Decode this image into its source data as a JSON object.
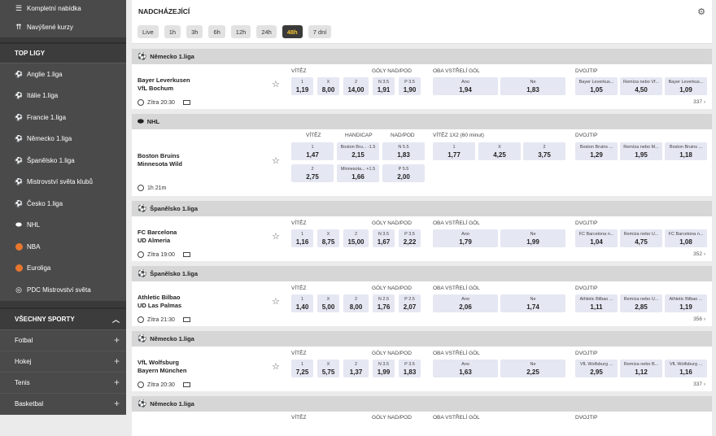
{
  "sidebar": {
    "top_items": [
      {
        "label": "Kompletní nabídka",
        "icon": "list-icon"
      },
      {
        "label": "Navýšené kurzy",
        "icon": "boost-icon"
      }
    ],
    "top_leagues_title": "TOP LIGY",
    "leagues": [
      {
        "label": "Anglie 1.liga",
        "icon": "soccer-ball-icon"
      },
      {
        "label": "Itálie 1.liga",
        "icon": "soccer-ball-icon"
      },
      {
        "label": "Francie 1.liga",
        "icon": "soccer-ball-icon"
      },
      {
        "label": "Německo 1.liga",
        "icon": "soccer-ball-icon"
      },
      {
        "label": "Španělsko 1.liga",
        "icon": "soccer-ball-icon"
      },
      {
        "label": "Mistrovství světa klubů",
        "icon": "soccer-ball-icon"
      },
      {
        "label": "Česko 1.liga",
        "icon": "soccer-ball-icon"
      },
      {
        "label": "NHL",
        "icon": "hockey-puck-icon"
      },
      {
        "label": "NBA",
        "icon": "basketball-icon"
      },
      {
        "label": "Euroliga",
        "icon": "basketball-icon"
      },
      {
        "label": "PDC Mistrovství světa",
        "icon": "darts-icon"
      }
    ],
    "all_sports_title": "VŠECHNY SPORTY",
    "sports": [
      "Fotbal",
      "Hokej",
      "Tenis",
      "Basketbal"
    ]
  },
  "header": {
    "title": "NADCHÁZEJÍCÍ",
    "tabs": [
      "Live",
      "1h",
      "3h",
      "6h",
      "12h",
      "24h",
      "48h",
      "7 dní"
    ],
    "active_tab": "48h"
  },
  "matches": [
    {
      "league": "Německo 1.liga",
      "sport": "soccer",
      "home": "Bayer Leverkusen",
      "away": "VfL Bochum",
      "time": "Zítra 20:30",
      "more": "337",
      "heads": [
        "VÍTĚZ",
        "GÓLY NAD/POD",
        "OBA VSTŘELÍ GÓL",
        "DVOJTIP"
      ],
      "odds": {
        "winner": [
          {
            "l": "1",
            "v": "1,19"
          },
          {
            "l": "X",
            "v": "8,00"
          },
          {
            "l": "2",
            "v": "14,00"
          }
        ],
        "goals": [
          {
            "l": "N 3.5",
            "v": "1,91"
          },
          {
            "l": "P 3.5",
            "v": "1,90"
          }
        ],
        "btts": [
          {
            "l": "Ano",
            "v": "1,94"
          },
          {
            "l": "Ne",
            "v": "1,83"
          }
        ],
        "double": [
          {
            "l": "Bayer Leverkus...",
            "v": "1,05"
          },
          {
            "l": "Remíza nebo Vf...",
            "v": "4,50"
          },
          {
            "l": "Bayer Leverkus...",
            "v": "1,09"
          }
        ]
      }
    },
    {
      "league": "Španělsko 1.liga",
      "sport": "soccer",
      "home": "FC Barcelona",
      "away": "UD Almeria",
      "time": "Zítra 19:00",
      "more": "352",
      "heads": [
        "VÍTĚZ",
        "GÓLY NAD/POD",
        "OBA VSTŘELÍ GÓL",
        "DVOJTIP"
      ],
      "odds": {
        "winner": [
          {
            "l": "1",
            "v": "1,16"
          },
          {
            "l": "X",
            "v": "8,75"
          },
          {
            "l": "2",
            "v": "15,00"
          }
        ],
        "goals": [
          {
            "l": "N 3.5",
            "v": "1,67"
          },
          {
            "l": "P 3.5",
            "v": "2,22"
          }
        ],
        "btts": [
          {
            "l": "Ano",
            "v": "1,79"
          },
          {
            "l": "Ne",
            "v": "1,99"
          }
        ],
        "double": [
          {
            "l": "FC Barcelona n...",
            "v": "1,04"
          },
          {
            "l": "Remíza nebo U...",
            "v": "4,75"
          },
          {
            "l": "FC Barcelona n...",
            "v": "1,08"
          }
        ]
      }
    },
    {
      "league": "Španělsko 1.liga",
      "sport": "soccer",
      "home": "Athletic Bilbao",
      "away": "UD Las Palmas",
      "time": "Zítra 21:30",
      "more": "356",
      "heads": [
        "VÍTĚZ",
        "GÓLY NAD/POD",
        "OBA VSTŘELÍ GÓL",
        "DVOJTIP"
      ],
      "odds": {
        "winner": [
          {
            "l": "1",
            "v": "1,40"
          },
          {
            "l": "X",
            "v": "5,00"
          },
          {
            "l": "2",
            "v": "8,00"
          }
        ],
        "goals": [
          {
            "l": "N 2.5",
            "v": "1,76"
          },
          {
            "l": "P 2.5",
            "v": "2,07"
          }
        ],
        "btts": [
          {
            "l": "Ano",
            "v": "2,06"
          },
          {
            "l": "Ne",
            "v": "1,74"
          }
        ],
        "double": [
          {
            "l": "Athletic Bilbao ...",
            "v": "1,11"
          },
          {
            "l": "Remíza nebo U...",
            "v": "2,85"
          },
          {
            "l": "Athletic Bilbao ...",
            "v": "1,19"
          }
        ]
      }
    },
    {
      "league": "Německo 1.liga",
      "sport": "soccer",
      "home": "VfL Wolfsburg",
      "away": "Bayern München",
      "time": "Zítra 20:30",
      "more": "337",
      "heads": [
        "VÍTĚZ",
        "GÓLY NAD/POD",
        "OBA VSTŘELÍ GÓL",
        "DVOJTIP"
      ],
      "odds": {
        "winner": [
          {
            "l": "1",
            "v": "7,25"
          },
          {
            "l": "X",
            "v": "5,75"
          },
          {
            "l": "2",
            "v": "1,37"
          }
        ],
        "goals": [
          {
            "l": "N 3.5",
            "v": "1,99"
          },
          {
            "l": "P 3.5",
            "v": "1,83"
          }
        ],
        "btts": [
          {
            "l": "Ano",
            "v": "1,63"
          },
          {
            "l": "Ne",
            "v": "2,25"
          }
        ],
        "double": [
          {
            "l": "VfL Wolfsburg ...",
            "v": "2,95"
          },
          {
            "l": "Remíza nebo B...",
            "v": "1,12"
          },
          {
            "l": "VfL Wolfsburg ...",
            "v": "1,16"
          }
        ]
      }
    }
  ],
  "nhl": {
    "league": "NHL",
    "home": "Boston Bruins",
    "away": "Minnesota Wild",
    "time": "1h 21m",
    "heads": [
      "VÍTĚZ",
      "HANDICAP",
      "NAD/POD",
      "VÍTĚZ 1X2 (60 minut)",
      "DVOJTIP"
    ],
    "winner": [
      {
        "l": "1",
        "v": "1,47"
      },
      {
        "l": "2",
        "v": "2,75"
      }
    ],
    "handicap": [
      {
        "l": "Boston Bru... -1.5",
        "v": "2,15"
      },
      {
        "l": "Minnesota... +1.5",
        "v": "1,66"
      }
    ],
    "overunder": [
      {
        "l": "N 5.5",
        "v": "1,83"
      },
      {
        "l": "P 5.5",
        "v": "2,00"
      }
    ],
    "x12": [
      {
        "l": "1",
        "v": "1,77"
      },
      {
        "l": "X",
        "v": "4,25"
      },
      {
        "l": "2",
        "v": "3,75"
      }
    ],
    "double": [
      {
        "l": "Boston Bruins ...",
        "v": "1,29"
      },
      {
        "l": "Remíza nebo M...",
        "v": "1,95"
      },
      {
        "l": "Boston Bruins ...",
        "v": "1,18"
      }
    ]
  },
  "last_league": {
    "league": "Německo 1.liga",
    "heads": [
      "VÍTĚZ",
      "GÓLY NAD/POD",
      "OBA VSTŘELÍ GÓL",
      "DVOJTIP"
    ]
  }
}
